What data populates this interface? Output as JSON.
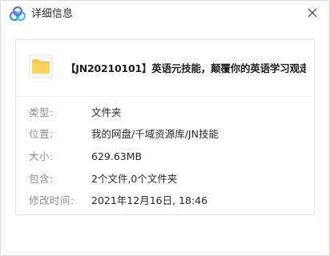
{
  "window": {
    "title": "详细信息",
    "close_icon": "close-icon",
    "app_icon": "cloud-drive-logo-icon"
  },
  "file": {
    "name": "【JN20210101】英语元技能，颠覆你的英语学习观走...",
    "icon": "folder-icon",
    "icon_color": "#F7C948"
  },
  "details": [
    {
      "label": "类型:",
      "value": "文件夹"
    },
    {
      "label": "位置:",
      "value": "我的网盘/千域资源库/JN技能"
    },
    {
      "label": "大小:",
      "value": "629.63MB"
    },
    {
      "label": "包含:",
      "value": "2个文件,0个文件夹"
    },
    {
      "label": "修改时间:",
      "value": "2021年12月16日, 18:46"
    }
  ]
}
